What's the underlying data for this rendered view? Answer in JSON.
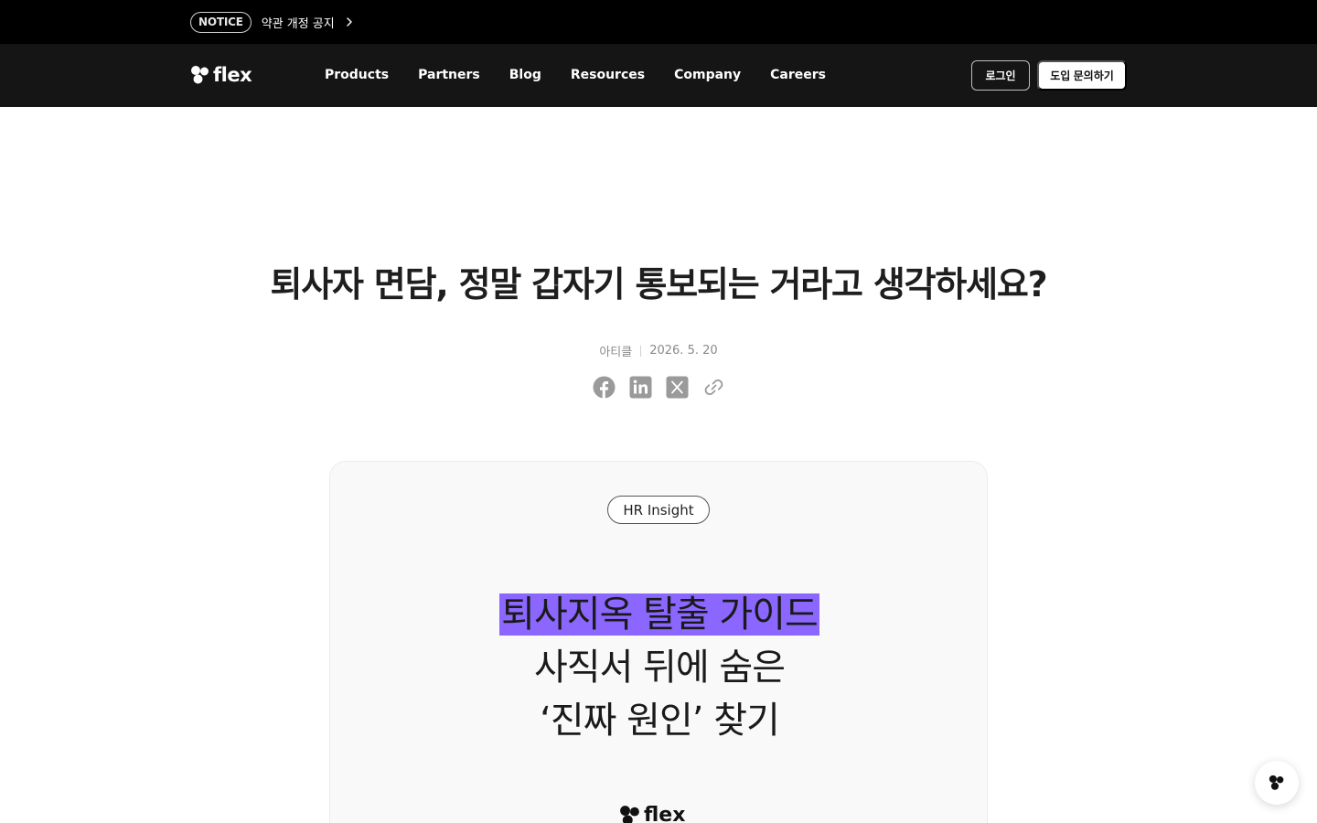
{
  "notice": {
    "badge": "NOTICE",
    "text": "약관 개정 공지",
    "chevron_icon": "chevron-right-icon"
  },
  "header": {
    "logo_text": "flex",
    "nav": [
      "Products",
      "Partners",
      "Blog",
      "Resources",
      "Company",
      "Careers"
    ],
    "login_label": "로그인",
    "demo_label": "도입 문의하기"
  },
  "article": {
    "title": "퇴사자 면담, 정말 갑자기 통보되는 거라고 생각하세요?",
    "category": "아티클",
    "date": "2026. 5. 20",
    "share_icons": [
      "facebook-icon",
      "linkedin-icon",
      "x-icon",
      "link-icon"
    ]
  },
  "hero": {
    "tag": "HR Insight",
    "line1": "퇴사지옥 탈출 가이드",
    "line2": "사직서 뒤에 숨은",
    "line3": "‘진짜 원인’ 찾기",
    "logo_text": "flex"
  },
  "colors": {
    "highlight": "#8b67ff",
    "header_bg": "#151515",
    "notice_bg": "#000000"
  }
}
